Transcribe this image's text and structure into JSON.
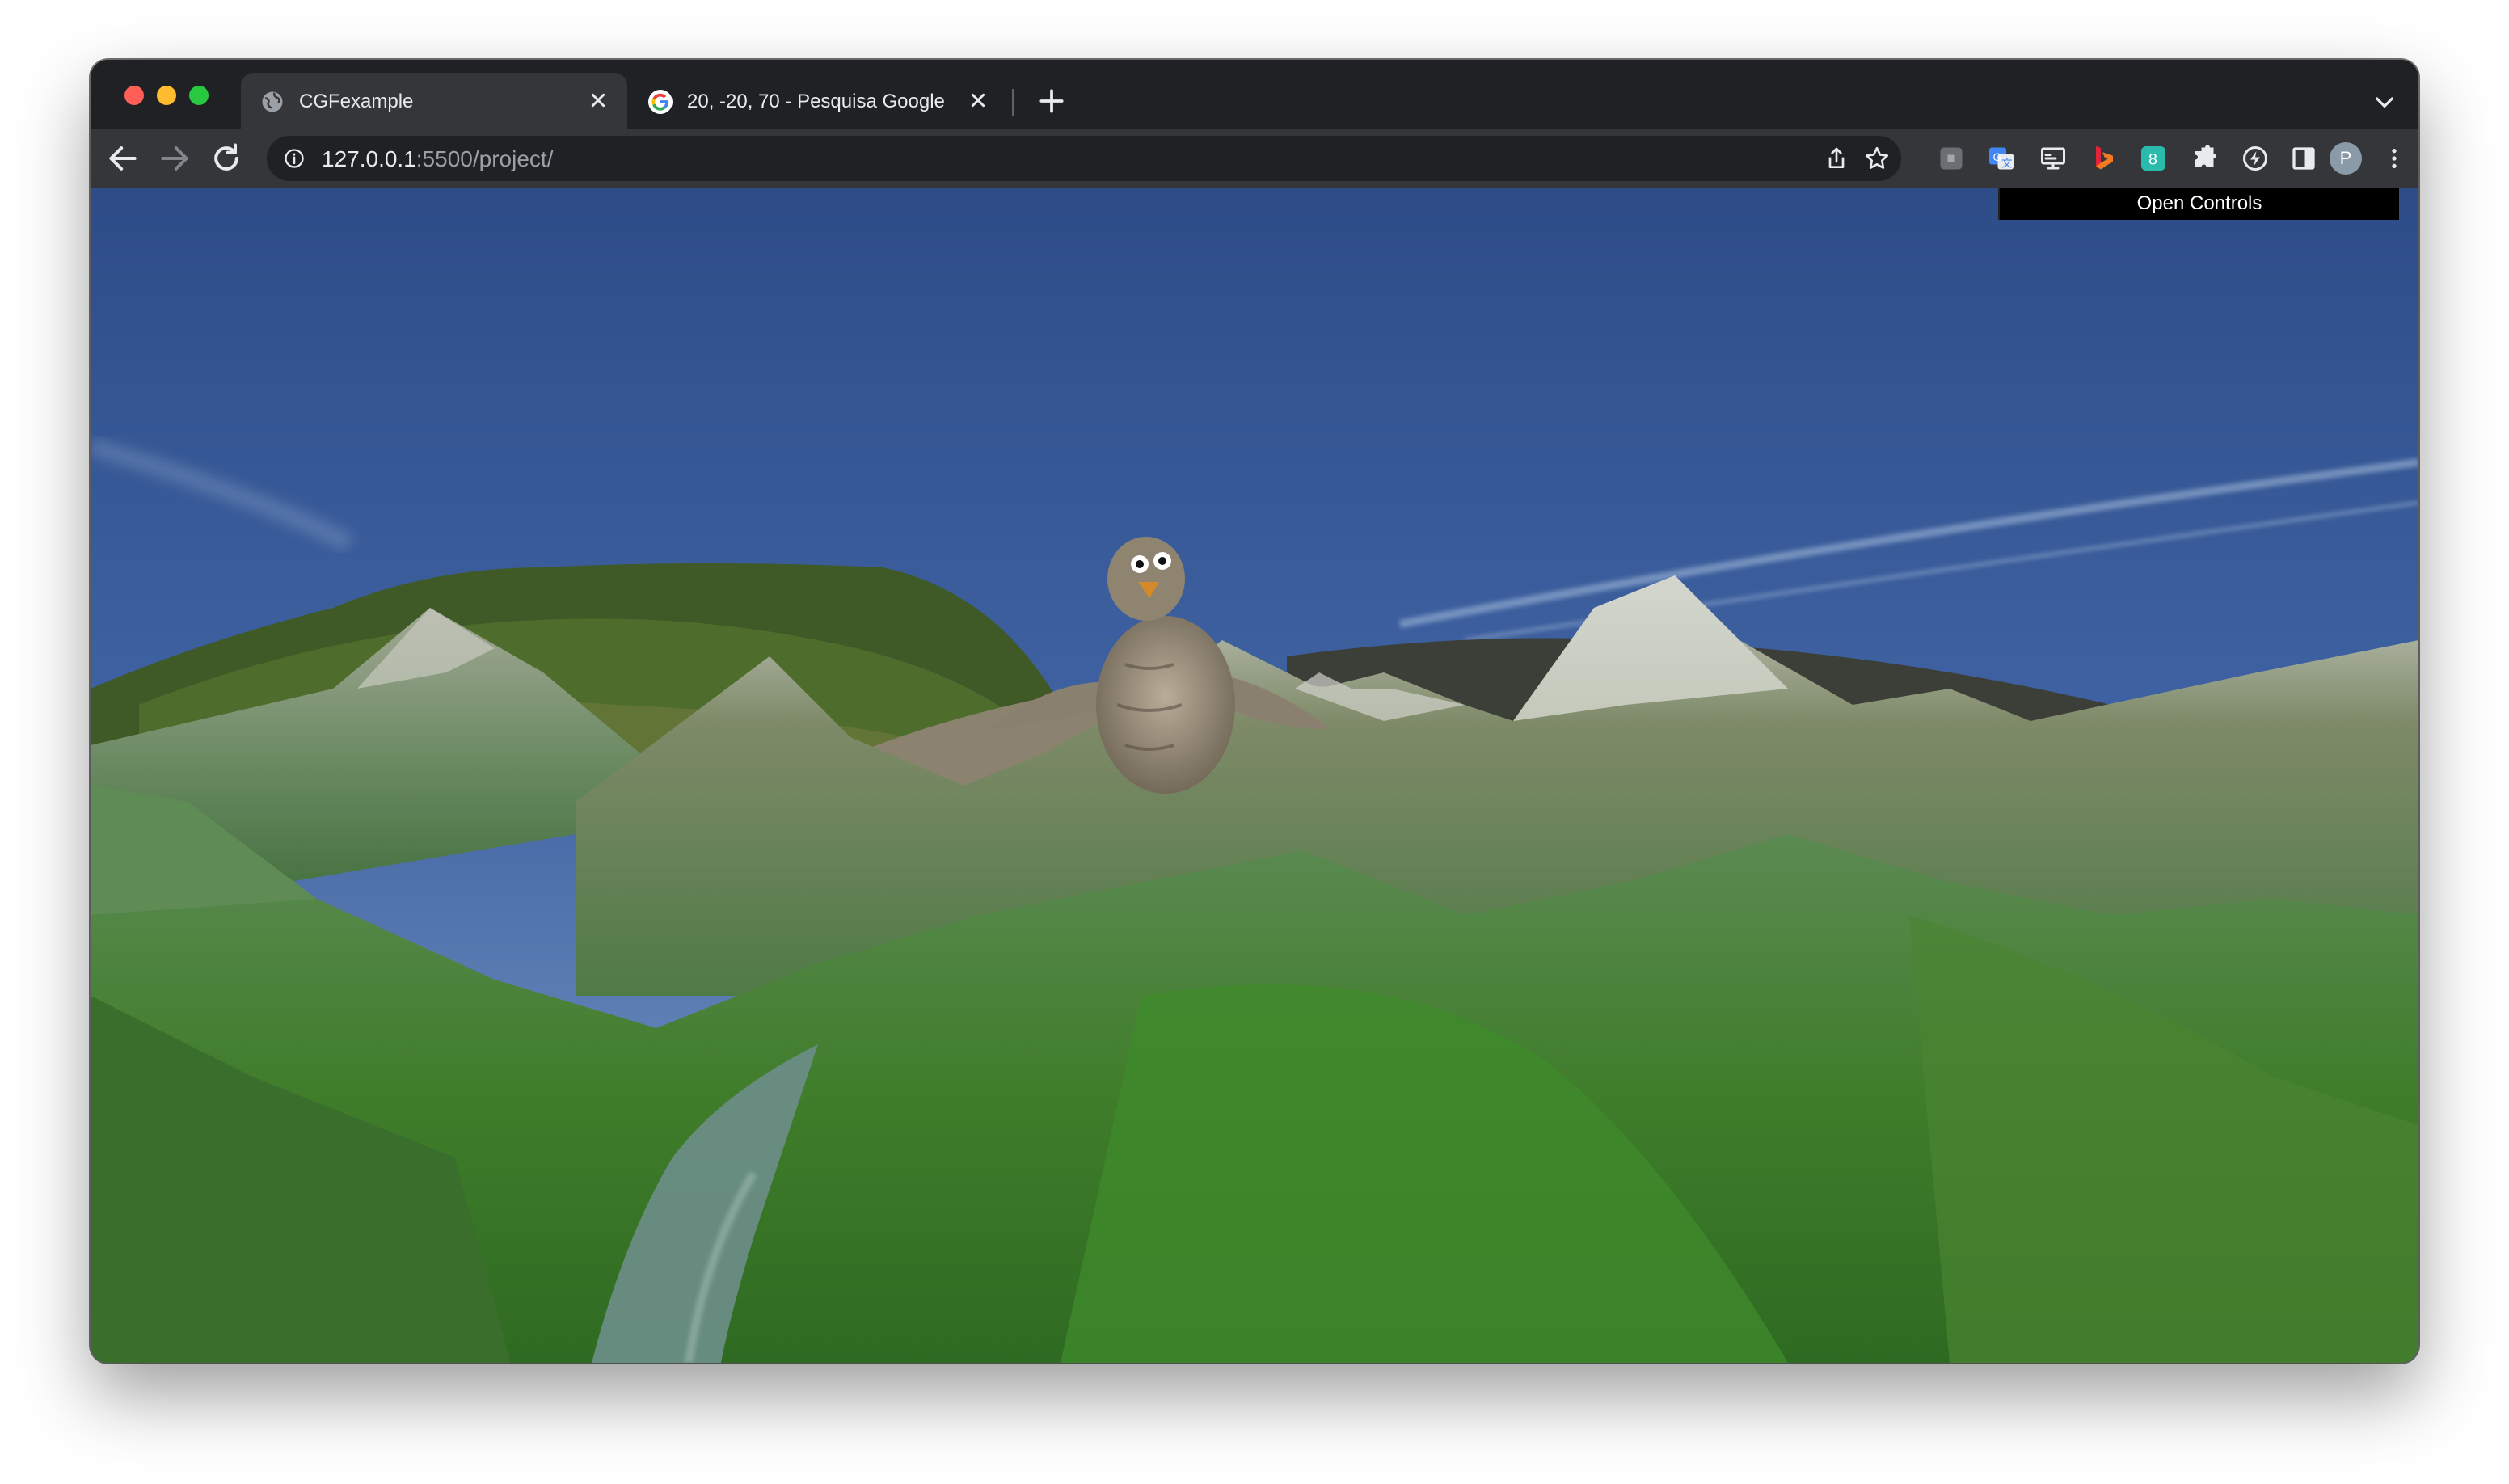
{
  "browser": {
    "tabs": [
      {
        "title": "CGFexample",
        "active": true,
        "favicon": "globe-icon"
      },
      {
        "title": "20, -20, 70 - Pesquisa Google",
        "active": false,
        "favicon": "google-g-icon"
      }
    ],
    "address": {
      "host": "127.0.0.1",
      "rest": ":5500/project/"
    },
    "profile_initial": "P",
    "extensions": [
      "extension-gray-icon",
      "google-translate-icon",
      "extension-monitor-icon",
      "bing-icon",
      "extension-teal-icon",
      "extensions-puzzle-icon",
      "extension-bolt-icon",
      "side-panel-icon"
    ]
  },
  "page": {
    "controls_label": "Open Controls",
    "scene": "penguin-on-terrain"
  },
  "colors": {
    "sky_top": "#2f4f8a",
    "sky_bottom": "#6c8fbd",
    "grass": "#3e7a2a",
    "panel": "#000000"
  }
}
